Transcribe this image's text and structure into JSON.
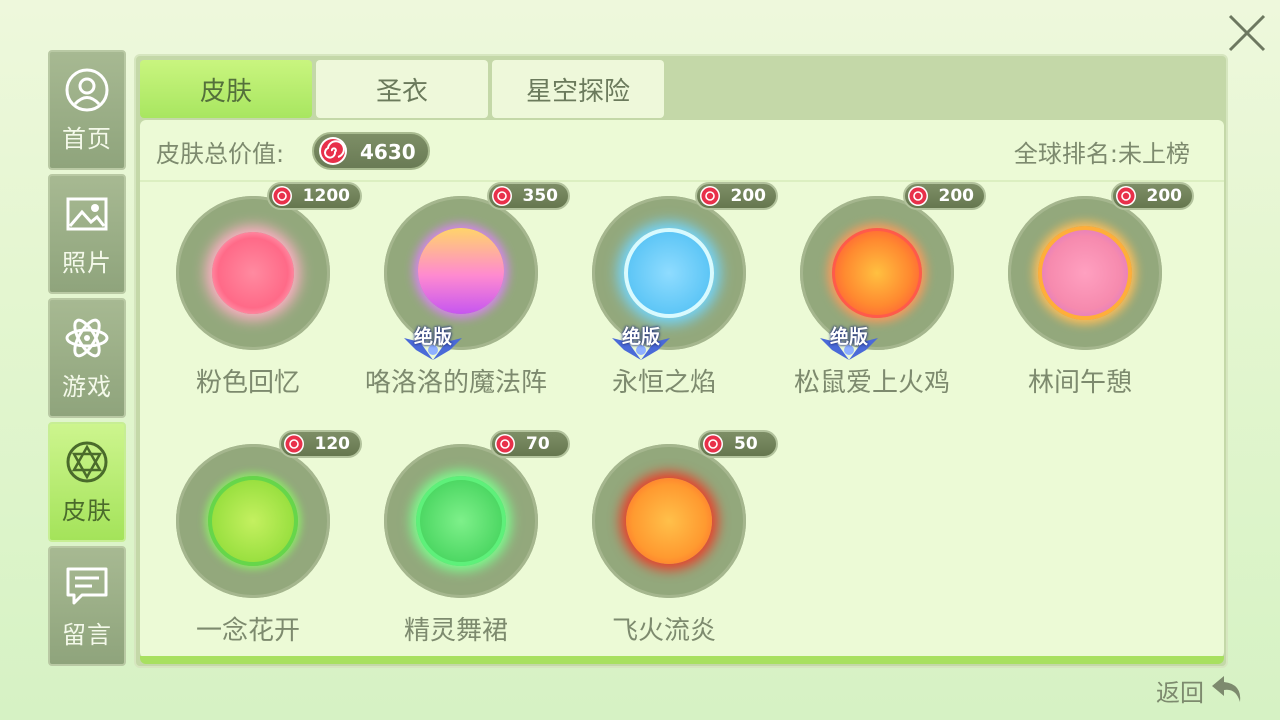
{
  "sidebar": {
    "items": [
      {
        "label": "首页",
        "icon": "user-icon"
      },
      {
        "label": "照片",
        "icon": "photo-icon"
      },
      {
        "label": "游戏",
        "icon": "atom-icon"
      },
      {
        "label": "皮肤",
        "icon": "skin-icon",
        "active": true
      },
      {
        "label": "留言",
        "icon": "message-icon"
      }
    ]
  },
  "tabs": [
    {
      "label": "皮肤",
      "active": true
    },
    {
      "label": "圣衣"
    },
    {
      "label": "星空探险"
    }
  ],
  "summary": {
    "total_label": "皮肤总价值:",
    "total_value": "4630",
    "rank_text": "全球排名:未上榜"
  },
  "skins": [
    {
      "name": "粉色回忆",
      "price": "1200",
      "limited": false,
      "color": "#ff7a98"
    },
    {
      "name": "咯洛洛的魔法阵",
      "price": "350",
      "limited": true,
      "limited_label": "绝版",
      "color": "#e874e8"
    },
    {
      "name": "永恒之焰",
      "price": "200",
      "limited": true,
      "limited_label": "绝版",
      "color": "#6ccaf2"
    },
    {
      "name": "松鼠爱上火鸡",
      "price": "200",
      "limited": true,
      "limited_label": "绝版",
      "color": "#ff8a3a"
    },
    {
      "name": "林间午憩",
      "price": "200",
      "limited": false,
      "color": "#f78ab0"
    },
    {
      "name": "一念花开",
      "price": "120",
      "limited": false,
      "color": "#a6e84a"
    },
    {
      "name": "精灵舞裙",
      "price": "70",
      "limited": false,
      "color": "#62e86a"
    },
    {
      "name": "飞火流炎",
      "price": "50",
      "limited": false,
      "color": "#ff8a2a"
    }
  ],
  "back_label": "返回",
  "colors": {
    "accent": "#a8e660",
    "panel": "#c4d8a8",
    "candy": "#e8304a"
  }
}
